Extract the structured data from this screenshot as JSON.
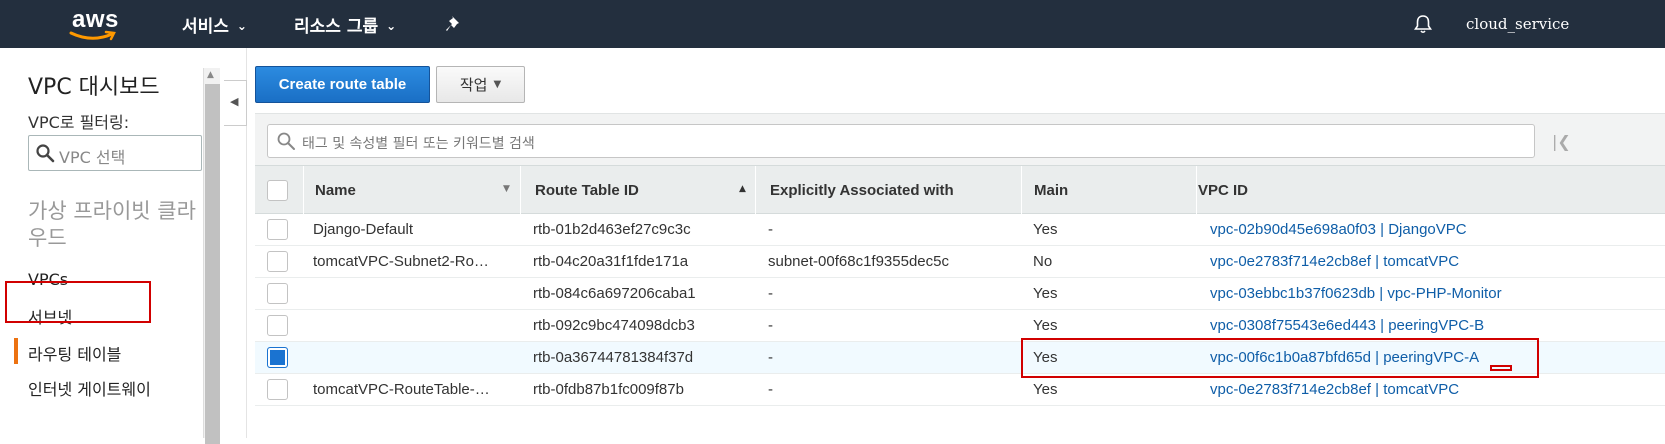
{
  "brand": {
    "logo_text": "aws"
  },
  "topnav": {
    "services": "서비스",
    "resource_groups": "리소스 그룹",
    "user": "cloud_service"
  },
  "sidebar": {
    "title": "VPC 대시보드",
    "filter_label": "VPC로 필터링:",
    "filter_placeholder": "VPC 선택",
    "section_title": "가상 프라이빗 클라우드",
    "items": [
      {
        "label": "VPCs"
      },
      {
        "label": "서브넷"
      },
      {
        "label": "라우팅 테이블",
        "active": true
      },
      {
        "label": "인터넷 게이트웨이"
      }
    ]
  },
  "toolbar": {
    "create_label": "Create route table",
    "actions_label": "작업"
  },
  "search": {
    "placeholder": "태그 및 속성별 필터 또는 키워드별 검색"
  },
  "table": {
    "columns": [
      "Name",
      "Route Table ID",
      "Explicitly Associated with",
      "Main",
      "VPC ID"
    ],
    "sorted_column": "Route Table ID",
    "rows": [
      {
        "name": "Django-Default",
        "id": "rtb-01b2d463ef27c9c3c",
        "assoc": "-",
        "main": "Yes",
        "vpc": "vpc-02b90d45e698a0f03 | DjangoVPC",
        "selected": false
      },
      {
        "name": "tomcatVPC-Subnet2-Ro…",
        "id": "rtb-04c20a31f1fde171a",
        "assoc": "subnet-00f68c1f9355dec5c",
        "main": "No",
        "vpc": "vpc-0e2783f714e2cb8ef | tomcatVPC",
        "selected": false
      },
      {
        "name": "",
        "id": "rtb-084c6a697206caba1",
        "assoc": "-",
        "main": "Yes",
        "vpc": "vpc-03ebbc1b37f0623db | vpc-PHP-Monitor",
        "selected": false
      },
      {
        "name": "",
        "id": "rtb-092c9bc474098dcb3",
        "assoc": "-",
        "main": "Yes",
        "vpc": "vpc-0308f75543e6ed443 | peeringVPC-B",
        "selected": false
      },
      {
        "name": "",
        "id": "rtb-0a36744781384f37d",
        "assoc": "-",
        "main": "Yes",
        "vpc": "vpc-00f6c1b0a87bfd65d | peeringVPC-A",
        "selected": true
      },
      {
        "name": "tomcatVPC-RouteTable-…",
        "id": "rtb-0fdb87b1fc009f87b",
        "assoc": "-",
        "main": "Yes",
        "vpc": "vpc-0e2783f714e2cb8ef | tomcatVPC",
        "selected": false
      }
    ]
  },
  "colors": {
    "nav_bg": "#232f3e",
    "primary": "#1a6fc5",
    "link": "#0f5ea8",
    "accent": "#ec7211",
    "highlight": "#d10000"
  }
}
